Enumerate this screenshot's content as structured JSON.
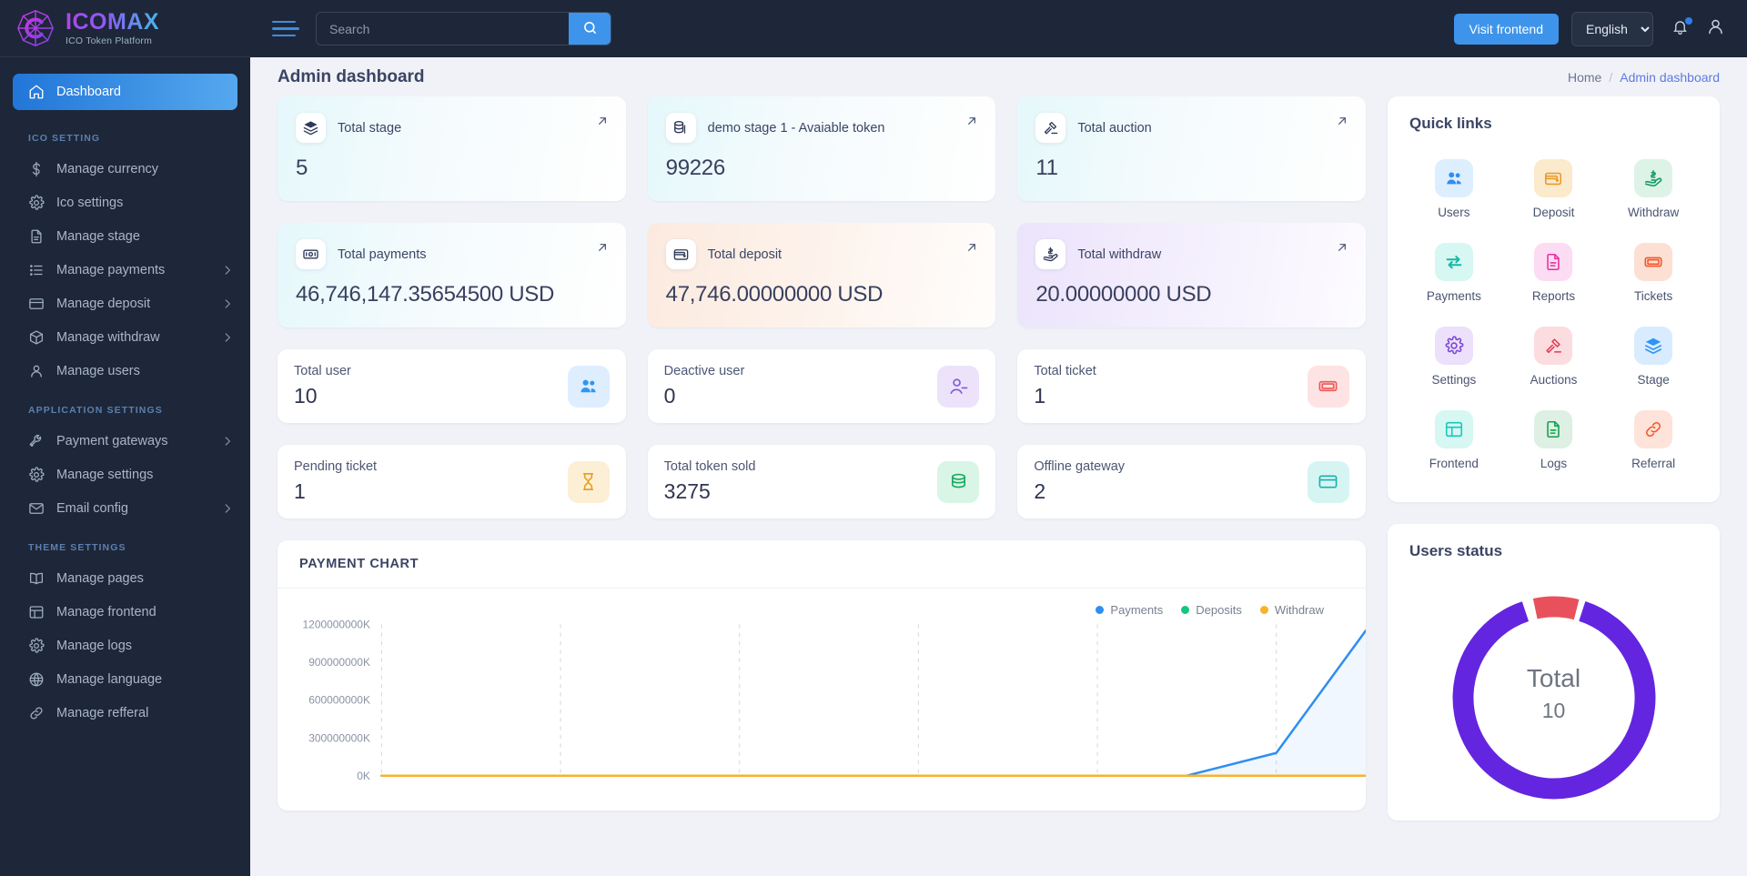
{
  "brand": {
    "name": "ICOMAX",
    "tagline": "ICO Token Platform"
  },
  "topbar": {
    "search_placeholder": "Search",
    "search_value": "",
    "visit_frontend": "Visit frontend",
    "language": "English",
    "language_options": [
      "English"
    ]
  },
  "page": {
    "title": "Admin dashboard",
    "breadcrumb_home": "Home",
    "breadcrumb_sep": "/",
    "breadcrumb_current": "Admin dashboard"
  },
  "sidebar": {
    "active": {
      "label": "Dashboard",
      "icon": "home-icon"
    },
    "sections": [
      {
        "title": "ICO SETTING",
        "items": [
          {
            "label": "Manage currency",
            "icon": "dollar-icon",
            "caret": false
          },
          {
            "label": "Ico settings",
            "icon": "gear-icon",
            "caret": false
          },
          {
            "label": "Manage stage",
            "icon": "document-icon",
            "caret": false
          },
          {
            "label": "Manage payments",
            "icon": "list-icon",
            "caret": true
          },
          {
            "label": "Manage deposit",
            "icon": "card-icon",
            "caret": true
          },
          {
            "label": "Manage withdraw",
            "icon": "box-icon",
            "caret": true
          },
          {
            "label": "Manage users",
            "icon": "user-icon",
            "caret": false
          }
        ]
      },
      {
        "title": "APPLICATION SETTINGS",
        "items": [
          {
            "label": "Payment gateways",
            "icon": "wrench-icon",
            "caret": true
          },
          {
            "label": "Manage settings",
            "icon": "gear-icon",
            "caret": false
          },
          {
            "label": "Email config",
            "icon": "mail-icon",
            "caret": true
          }
        ]
      },
      {
        "title": "THEME SETTINGS",
        "items": [
          {
            "label": "Manage pages",
            "icon": "book-icon",
            "caret": false
          },
          {
            "label": "Manage frontend",
            "icon": "layout-icon",
            "caret": false
          },
          {
            "label": "Manage logs",
            "icon": "gear-icon",
            "caret": false
          },
          {
            "label": "Manage language",
            "icon": "globe-icon",
            "caret": false
          },
          {
            "label": "Manage refferal",
            "icon": "link-icon",
            "caret": false
          }
        ]
      }
    ]
  },
  "stats_gradient": [
    {
      "label": "Total stage",
      "value": "5",
      "icon": "stack-icon",
      "theme": "g-cyan"
    },
    {
      "label": "demo stage 1 - Avaiable token",
      "value": "99226",
      "icon": "coins-icon",
      "theme": "g-cyan"
    },
    {
      "label": "Total auction",
      "value": "11",
      "icon": "gavel-icon",
      "theme": "g-cyan"
    },
    {
      "label": "Total payments",
      "value": "46,746,147.35654500 USD",
      "icon": "money-icon",
      "theme": "g-cyan"
    },
    {
      "label": "Total deposit",
      "value": "47,746.00000000 USD",
      "icon": "wallet-icon",
      "theme": "g-peach"
    },
    {
      "label": "Total withdraw",
      "value": "20.00000000 USD",
      "icon": "handcash-icon",
      "theme": "g-violet"
    }
  ],
  "stats_white": [
    {
      "label": "Total user",
      "value": "10",
      "icon": "users-icon",
      "bg": "#deeeff",
      "fg": "#2f96f0"
    },
    {
      "label": "Deactive user",
      "value": "0",
      "icon": "user-minus-icon",
      "bg": "#ece3fb",
      "fg": "#7f56d9"
    },
    {
      "label": "Total ticket",
      "value": "1",
      "icon": "ticket-icon",
      "bg": "#fde3e3",
      "fg": "#ef5555"
    },
    {
      "label": "Pending ticket",
      "value": "1",
      "icon": "hourglass-icon",
      "bg": "#fcefd6",
      "fg": "#e8a020"
    },
    {
      "label": "Total token sold",
      "value": "3275",
      "icon": "coinstack-icon",
      "bg": "#d9f5e6",
      "fg": "#18a862"
    },
    {
      "label": "Offline gateway",
      "value": "2",
      "icon": "creditcard-icon",
      "bg": "#d6f5f2",
      "fg": "#19b3ad"
    }
  ],
  "quick_links": {
    "title": "Quick links",
    "items": [
      {
        "label": "Users",
        "icon": "users-icon",
        "bg": "#ddeeff",
        "fg": "#2f8ef0"
      },
      {
        "label": "Deposit",
        "icon": "wallet-icon",
        "bg": "#fbeacb",
        "fg": "#e79b2c"
      },
      {
        "label": "Withdraw",
        "icon": "handcash-icon",
        "bg": "#ddf3e7",
        "fg": "#139a63"
      },
      {
        "label": "Payments",
        "icon": "exchange-icon",
        "bg": "#d6f7f2",
        "fg": "#16b8a8"
      },
      {
        "label": "Reports",
        "icon": "document-icon",
        "bg": "#fbdcf2",
        "fg": "#e8309f"
      },
      {
        "label": "Tickets",
        "icon": "ticket-icon",
        "bg": "#fde0d4",
        "fg": "#f5562a"
      },
      {
        "label": "Settings",
        "icon": "gear-icon",
        "bg": "#ece0fb",
        "fg": "#7b46d4"
      },
      {
        "label": "Auctions",
        "icon": "gavel-icon",
        "bg": "#fbdde0",
        "fg": "#e23b52"
      },
      {
        "label": "Stage",
        "icon": "stack-icon",
        "bg": "#d9ecff",
        "fg": "#2f94f5"
      },
      {
        "label": "Frontend",
        "icon": "layout-icon",
        "bg": "#d6f7f2",
        "fg": "#18c6bc"
      },
      {
        "label": "Logs",
        "icon": "document-icon",
        "bg": "#ddf0e3",
        "fg": "#14a04c"
      },
      {
        "label": "Referral",
        "icon": "link-icon",
        "bg": "#fde3d9",
        "fg": "#f5562a"
      }
    ]
  },
  "users_status": {
    "title": "Users status",
    "center_label": "Total",
    "center_value": "10"
  },
  "chart_data": {
    "type": "line",
    "title": "PAYMENT CHART",
    "xlabel": "",
    "ylabel": "",
    "grid": true,
    "legend_position": "top-right",
    "ytick_labels": [
      "0K",
      "300000000K",
      "600000000K",
      "900000000K",
      "1200000000K"
    ],
    "ylim": [
      0,
      1200000000
    ],
    "x": [
      "1",
      "2",
      "3",
      "4",
      "5",
      "6",
      "7",
      "8",
      "9",
      "10",
      "11",
      "12"
    ],
    "series": [
      {
        "name": "Payments",
        "color": "#2f8ef0",
        "values": [
          0,
          0,
          0,
          0,
          0,
          0,
          0,
          0,
          0,
          0,
          180000000,
          1150000000
        ]
      },
      {
        "name": "Deposits",
        "color": "#10c97f",
        "values": [
          0,
          0,
          0,
          0,
          0,
          0,
          0,
          0,
          0,
          0,
          0,
          0
        ]
      },
      {
        "name": "Withdraw",
        "color": "#f7b32b",
        "values": [
          0,
          0,
          0,
          0,
          0,
          0,
          0,
          0,
          0,
          0,
          0,
          0
        ]
      }
    ]
  }
}
